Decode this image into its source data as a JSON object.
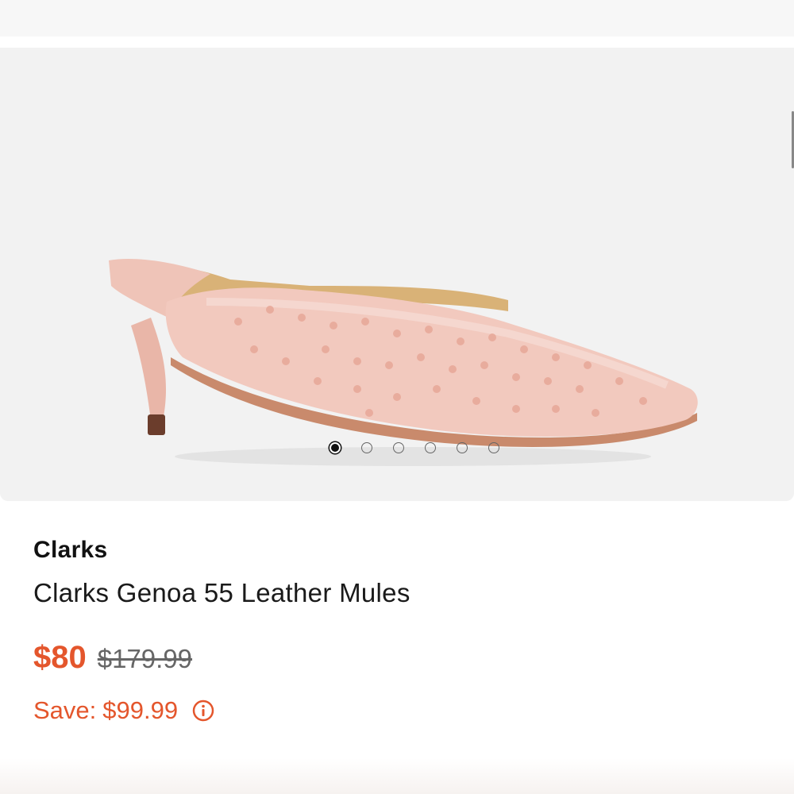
{
  "product": {
    "brand": "Clarks",
    "title": "Clarks Genoa 55 Leather Mules",
    "price_current": "$80",
    "price_original": "$179.99",
    "save_label": "Save:",
    "save_amount": "$99.99",
    "info_icon": "info-circle-icon"
  },
  "carousel": {
    "total_images": 6,
    "active_index": 1
  },
  "colors": {
    "sale_accent": "#e4562c",
    "image_background": "#f2f2f2",
    "shoe_body": "#f2c9be"
  }
}
